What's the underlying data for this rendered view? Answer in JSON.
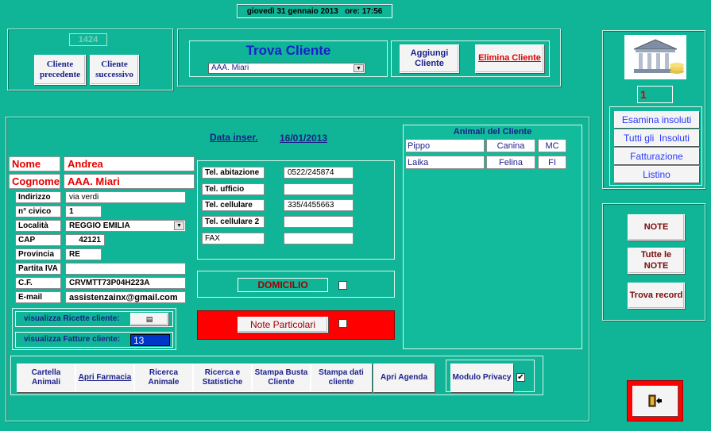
{
  "datetime": {
    "text": "giovedì 31 gennaio 2013   ore: 17:56"
  },
  "nav": {
    "record_number": "1424",
    "prev_label": "Cliente precedente",
    "next_label": "Cliente successivo"
  },
  "search": {
    "title": "Trova Cliente",
    "selected": "AAA. Miari",
    "add_label": "Aggiungi Cliente",
    "delete_label": "Elimina Cliente"
  },
  "side": {
    "counter": "1",
    "buttons": [
      "Esamina insoluti",
      "Tutti gli  Insoluti",
      "Fatturazione",
      "Listino"
    ],
    "note_label": "NOTE",
    "all_notes_label": "Tutte le NOTE",
    "find_record_label": "Trova record"
  },
  "client": {
    "date_label": "Data inser.",
    "date_value": "16/01/2013",
    "nome_label": "Nome",
    "nome": "Andrea",
    "cognome_label": "Cognome",
    "cognome": "AAA. Miari",
    "fields": [
      {
        "label": "Indirizzo",
        "value": "via verdi"
      },
      {
        "label": "n° civico",
        "value": "1"
      },
      {
        "label": "Località",
        "value": "REGGIO EMILIA"
      },
      {
        "label": "CAP",
        "value": "42121"
      },
      {
        "label": "Provincia",
        "value": "RE"
      },
      {
        "label": "Partita IVA",
        "value": ""
      },
      {
        "label": "C.F.",
        "value": "CRVMTT73P04H223A"
      },
      {
        "label": "E-mail",
        "value": "assistenzainx@gmail.com"
      }
    ],
    "phones": [
      {
        "label": "Tel. abitazione",
        "value": "0522/245874"
      },
      {
        "label": "Tel. ufficio",
        "value": ""
      },
      {
        "label": "Tel. cellulare",
        "value": "335/4455663"
      },
      {
        "label": "Tel. cellulare 2",
        "value": ""
      },
      {
        "label": "FAX",
        "value": ""
      }
    ],
    "ricette_label": "visualizza Ricette cliente:",
    "fatture_label": "visualizza Fatture cliente:",
    "fatture_value": "13",
    "domicilio_label": "DOMICILIO",
    "note_particolari_label": "Note Particolari"
  },
  "animals": {
    "title": "Animali del Cliente",
    "rows": [
      {
        "name": "Pippo",
        "species": "Canina",
        "code": "MC"
      },
      {
        "name": "Laika",
        "species": "Felina",
        "code": "FI"
      }
    ]
  },
  "toolbar": {
    "buttons": [
      "Cartella Animali",
      "Apri Farmacia",
      "Ricerca Animale",
      "Ricerca e Statistiche",
      "Stampa Busta Cliente",
      "Stampa dati cliente",
      "Apri Agenda"
    ],
    "privacy_label": "Modulo Privacy",
    "privacy_checked": "✔"
  },
  "icons": {
    "bank": "bank-icon",
    "exit": "exit-door-icon",
    "dropdown": "chevron-down-icon",
    "ricette": "list-icon"
  },
  "colors": {
    "background": "#0fb596",
    "alert_red": "#ff0000",
    "navy_text": "#1b1f8a",
    "link_blue": "#2a39ff"
  }
}
